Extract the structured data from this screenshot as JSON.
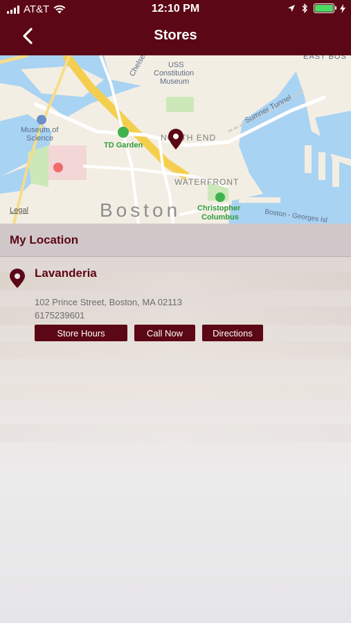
{
  "status": {
    "carrier": "AT&T",
    "time": "12:10 PM",
    "battery_level": 1.0
  },
  "nav": {
    "title": "Stores",
    "back_icon": "chevron-left-icon"
  },
  "map": {
    "labels": {
      "uss": "USS",
      "constitution": "Constitution",
      "museum": "Museum",
      "museum_of": "Museum of",
      "science": "Science",
      "td_garden": "TD Garden",
      "north_end": "NORTH END",
      "waterfront": "WATERFRONT",
      "christopher": "Christopher",
      "columbus": "Columbus",
      "sumner_tunnel": "Sumner Tunnel",
      "east_boston": "EAST BOS",
      "chelsea": "Chelsea",
      "georges": "Boston - Georges Isl",
      "city": "Boston"
    },
    "legal": "Legal"
  },
  "section": {
    "title": "My Location"
  },
  "store": {
    "name": "Lavanderia",
    "address": "102 Prince Street, Boston, MA 02113",
    "phone": "6175239601",
    "buttons": {
      "hours": "Store Hours",
      "call": "Call Now",
      "directions": "Directions"
    }
  },
  "colors": {
    "brand": "#5c0715",
    "battery": "#4cd964"
  }
}
